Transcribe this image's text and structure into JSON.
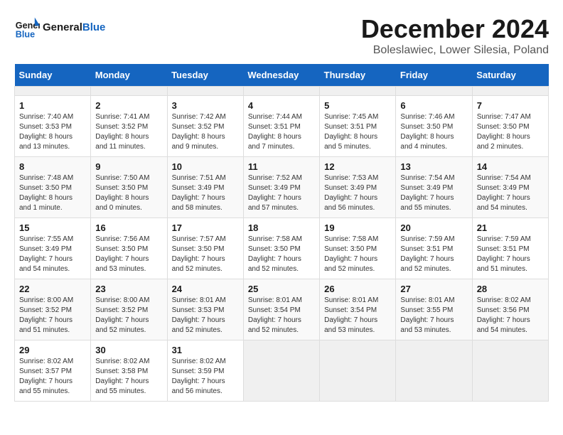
{
  "header": {
    "logo_text_general": "General",
    "logo_text_blue": "Blue",
    "main_title": "December 2024",
    "subtitle": "Boleslawiec, Lower Silesia, Poland"
  },
  "calendar": {
    "days_of_week": [
      "Sunday",
      "Monday",
      "Tuesday",
      "Wednesday",
      "Thursday",
      "Friday",
      "Saturday"
    ],
    "weeks": [
      [
        {
          "day": "",
          "empty": true
        },
        {
          "day": "",
          "empty": true
        },
        {
          "day": "",
          "empty": true
        },
        {
          "day": "",
          "empty": true
        },
        {
          "day": "",
          "empty": true
        },
        {
          "day": "",
          "empty": true
        },
        {
          "day": "",
          "empty": true
        }
      ],
      [
        {
          "day": "1",
          "sunrise": "Sunrise: 7:40 AM",
          "sunset": "Sunset: 3:53 PM",
          "daylight": "Daylight: 8 hours and 13 minutes."
        },
        {
          "day": "2",
          "sunrise": "Sunrise: 7:41 AM",
          "sunset": "Sunset: 3:52 PM",
          "daylight": "Daylight: 8 hours and 11 minutes."
        },
        {
          "day": "3",
          "sunrise": "Sunrise: 7:42 AM",
          "sunset": "Sunset: 3:52 PM",
          "daylight": "Daylight: 8 hours and 9 minutes."
        },
        {
          "day": "4",
          "sunrise": "Sunrise: 7:44 AM",
          "sunset": "Sunset: 3:51 PM",
          "daylight": "Daylight: 8 hours and 7 minutes."
        },
        {
          "day": "5",
          "sunrise": "Sunrise: 7:45 AM",
          "sunset": "Sunset: 3:51 PM",
          "daylight": "Daylight: 8 hours and 5 minutes."
        },
        {
          "day": "6",
          "sunrise": "Sunrise: 7:46 AM",
          "sunset": "Sunset: 3:50 PM",
          "daylight": "Daylight: 8 hours and 4 minutes."
        },
        {
          "day": "7",
          "sunrise": "Sunrise: 7:47 AM",
          "sunset": "Sunset: 3:50 PM",
          "daylight": "Daylight: 8 hours and 2 minutes."
        }
      ],
      [
        {
          "day": "8",
          "sunrise": "Sunrise: 7:48 AM",
          "sunset": "Sunset: 3:50 PM",
          "daylight": "Daylight: 8 hours and 1 minute."
        },
        {
          "day": "9",
          "sunrise": "Sunrise: 7:50 AM",
          "sunset": "Sunset: 3:50 PM",
          "daylight": "Daylight: 8 hours and 0 minutes."
        },
        {
          "day": "10",
          "sunrise": "Sunrise: 7:51 AM",
          "sunset": "Sunset: 3:49 PM",
          "daylight": "Daylight: 7 hours and 58 minutes."
        },
        {
          "day": "11",
          "sunrise": "Sunrise: 7:52 AM",
          "sunset": "Sunset: 3:49 PM",
          "daylight": "Daylight: 7 hours and 57 minutes."
        },
        {
          "day": "12",
          "sunrise": "Sunrise: 7:53 AM",
          "sunset": "Sunset: 3:49 PM",
          "daylight": "Daylight: 7 hours and 56 minutes."
        },
        {
          "day": "13",
          "sunrise": "Sunrise: 7:54 AM",
          "sunset": "Sunset: 3:49 PM",
          "daylight": "Daylight: 7 hours and 55 minutes."
        },
        {
          "day": "14",
          "sunrise": "Sunrise: 7:54 AM",
          "sunset": "Sunset: 3:49 PM",
          "daylight": "Daylight: 7 hours and 54 minutes."
        }
      ],
      [
        {
          "day": "15",
          "sunrise": "Sunrise: 7:55 AM",
          "sunset": "Sunset: 3:49 PM",
          "daylight": "Daylight: 7 hours and 54 minutes."
        },
        {
          "day": "16",
          "sunrise": "Sunrise: 7:56 AM",
          "sunset": "Sunset: 3:50 PM",
          "daylight": "Daylight: 7 hours and 53 minutes."
        },
        {
          "day": "17",
          "sunrise": "Sunrise: 7:57 AM",
          "sunset": "Sunset: 3:50 PM",
          "daylight": "Daylight: 7 hours and 52 minutes."
        },
        {
          "day": "18",
          "sunrise": "Sunrise: 7:58 AM",
          "sunset": "Sunset: 3:50 PM",
          "daylight": "Daylight: 7 hours and 52 minutes."
        },
        {
          "day": "19",
          "sunrise": "Sunrise: 7:58 AM",
          "sunset": "Sunset: 3:50 PM",
          "daylight": "Daylight: 7 hours and 52 minutes."
        },
        {
          "day": "20",
          "sunrise": "Sunrise: 7:59 AM",
          "sunset": "Sunset: 3:51 PM",
          "daylight": "Daylight: 7 hours and 52 minutes."
        },
        {
          "day": "21",
          "sunrise": "Sunrise: 7:59 AM",
          "sunset": "Sunset: 3:51 PM",
          "daylight": "Daylight: 7 hours and 51 minutes."
        }
      ],
      [
        {
          "day": "22",
          "sunrise": "Sunrise: 8:00 AM",
          "sunset": "Sunset: 3:52 PM",
          "daylight": "Daylight: 7 hours and 51 minutes."
        },
        {
          "day": "23",
          "sunrise": "Sunrise: 8:00 AM",
          "sunset": "Sunset: 3:52 PM",
          "daylight": "Daylight: 7 hours and 52 minutes."
        },
        {
          "day": "24",
          "sunrise": "Sunrise: 8:01 AM",
          "sunset": "Sunset: 3:53 PM",
          "daylight": "Daylight: 7 hours and 52 minutes."
        },
        {
          "day": "25",
          "sunrise": "Sunrise: 8:01 AM",
          "sunset": "Sunset: 3:54 PM",
          "daylight": "Daylight: 7 hours and 52 minutes."
        },
        {
          "day": "26",
          "sunrise": "Sunrise: 8:01 AM",
          "sunset": "Sunset: 3:54 PM",
          "daylight": "Daylight: 7 hours and 53 minutes."
        },
        {
          "day": "27",
          "sunrise": "Sunrise: 8:01 AM",
          "sunset": "Sunset: 3:55 PM",
          "daylight": "Daylight: 7 hours and 53 minutes."
        },
        {
          "day": "28",
          "sunrise": "Sunrise: 8:02 AM",
          "sunset": "Sunset: 3:56 PM",
          "daylight": "Daylight: 7 hours and 54 minutes."
        }
      ],
      [
        {
          "day": "29",
          "sunrise": "Sunrise: 8:02 AM",
          "sunset": "Sunset: 3:57 PM",
          "daylight": "Daylight: 7 hours and 55 minutes."
        },
        {
          "day": "30",
          "sunrise": "Sunrise: 8:02 AM",
          "sunset": "Sunset: 3:58 PM",
          "daylight": "Daylight: 7 hours and 55 minutes."
        },
        {
          "day": "31",
          "sunrise": "Sunrise: 8:02 AM",
          "sunset": "Sunset: 3:59 PM",
          "daylight": "Daylight: 7 hours and 56 minutes."
        },
        {
          "day": "",
          "empty": true
        },
        {
          "day": "",
          "empty": true
        },
        {
          "day": "",
          "empty": true
        },
        {
          "day": "",
          "empty": true
        }
      ]
    ]
  }
}
